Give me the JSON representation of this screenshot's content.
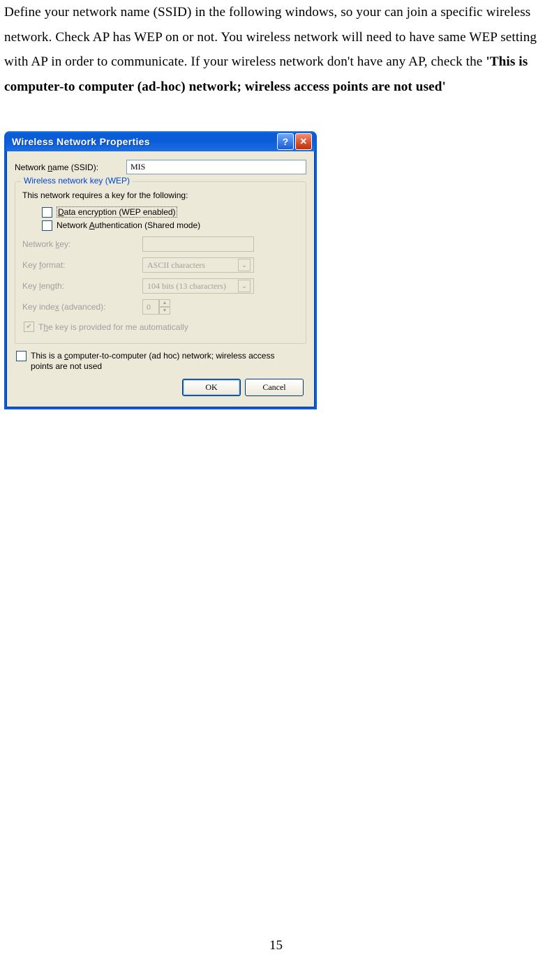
{
  "instruction": {
    "text_plain": "Define your network name (SSID) in the following windows, so your can join a specific wireless network. Check AP has WEP on or not. You wireless network will need to have same WEP setting with AP in order to communicate. If your wireless network don't have any AP, check the  ",
    "bold": "'This is computer-to computer (ad-hoc) network; wireless access points are not used'"
  },
  "dialog": {
    "title": "Wireless Network Properties",
    "ssid_label": "Network name (SSID):",
    "ssid_value": "MIS",
    "group_label": "Wireless network key (WEP)",
    "group_text": "This network requires a key for the following:",
    "check_data": "Data encryption (WEP enabled)",
    "check_auth": "Network Authentication (Shared mode)",
    "key_label": "Network key:",
    "key_value": "",
    "format_label": "Key format:",
    "format_value": "ASCII characters",
    "length_label": "Key length:",
    "length_value": "104 bits (13 characters)",
    "index_label": "Key index (advanced):",
    "index_value": "0",
    "auto_label": "The key is provided for me automatically",
    "adhoc_label": "This is a computer-to-computer (ad hoc) network; wireless access points are not used",
    "ok": "OK",
    "cancel": "Cancel"
  },
  "page_number": "15"
}
